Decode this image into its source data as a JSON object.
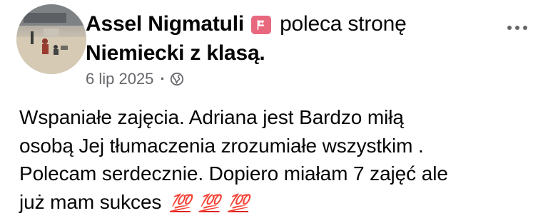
{
  "post": {
    "author": "Assel Nigmatuli",
    "action": "poleca stronę",
    "page_name": "Niemiecki z klasą.",
    "date": "6 lip 2025",
    "separator": "·",
    "audience_icon": "globe-icon",
    "recommend_badge_icon": "star-flag-icon",
    "more_icon": "more-options-icon",
    "body_lines": [
      "Wspaniałe zajęcia. Adriana jest Bardzo miłą",
      "osobą Jej tłumaczenia zrozumiałe wszystkim .",
      "Polecam serdecznie. Dopiero miałam 7 zajęć ale",
      "już mam sukces"
    ],
    "emoji": [
      "💯",
      "💯",
      "💯"
    ]
  },
  "colors": {
    "text": "#050505",
    "secondary": "#65676b",
    "badge": "#e8687e",
    "emoji": "#e02424"
  }
}
